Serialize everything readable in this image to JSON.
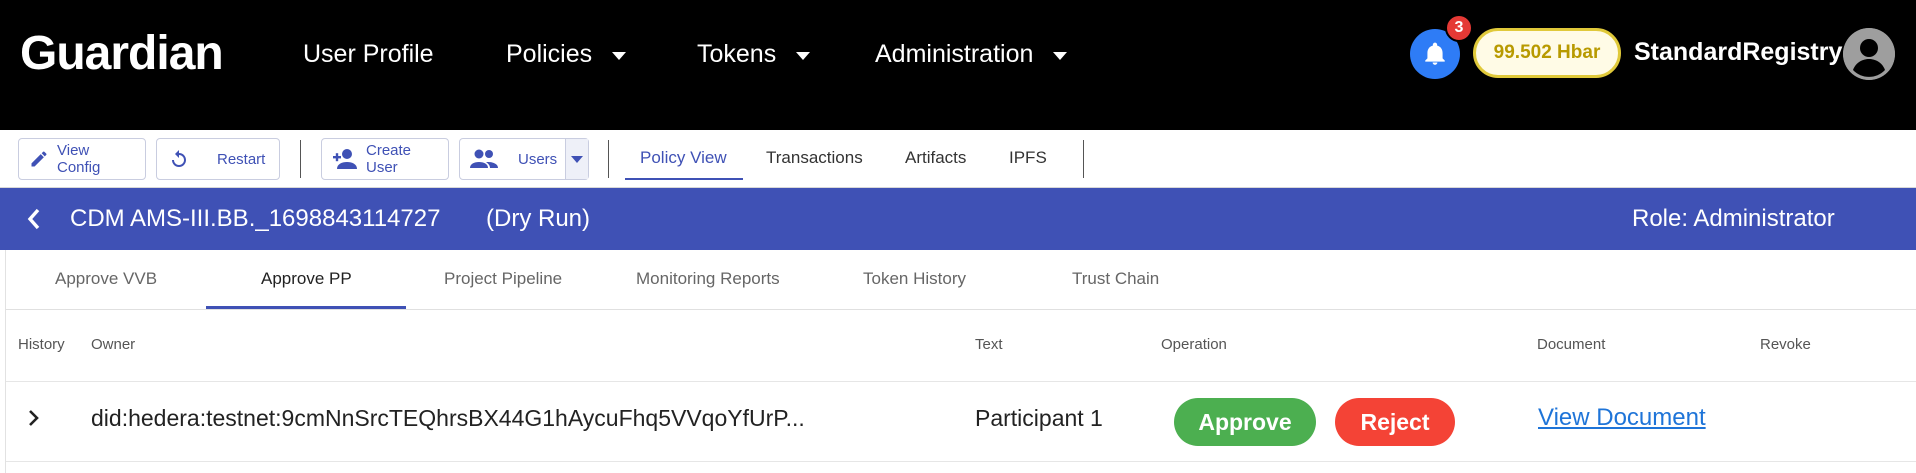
{
  "header": {
    "brand": "Guardian",
    "nav": [
      {
        "label": "User Profile",
        "dropdown": false
      },
      {
        "label": "Policies",
        "dropdown": true
      },
      {
        "label": "Tokens",
        "dropdown": true
      },
      {
        "label": "Administration",
        "dropdown": true
      }
    ],
    "notifications_count": "3",
    "balance": "99.502 Hbar",
    "username": "StandardRegistry"
  },
  "toolbar": {
    "view_config": "View Config",
    "restart": "Restart",
    "create_user": "Create User",
    "users": "Users",
    "tabs": [
      "Policy View",
      "Transactions",
      "Artifacts",
      "IPFS"
    ],
    "active_tab": "Policy View"
  },
  "policy": {
    "name": "CDM AMS-III.BB._1698843114727",
    "mode": "(Dry Run)",
    "role": "Role: Administrator"
  },
  "block_tabs": {
    "items": [
      "Approve VVB",
      "Approve PP",
      "Project Pipeline",
      "Monitoring Reports",
      "Token History",
      "Trust Chain"
    ],
    "active": "Approve PP"
  },
  "table": {
    "columns": [
      "History",
      "Owner",
      "Text",
      "Operation",
      "Document",
      "Revoke"
    ],
    "rows": [
      {
        "owner": "did:hedera:testnet:9cmNnSrcTEQhrsBX44G1hAycuFhq5VVqoYfUrP...",
        "text": "Participant 1",
        "approve": "Approve",
        "reject": "Reject",
        "document": "View Document"
      }
    ]
  },
  "colors": {
    "primary": "#3f51b5",
    "approve": "#4caf50",
    "reject": "#f44336",
    "balance_border": "#e0c93a",
    "bell": "#2e7cf6"
  }
}
